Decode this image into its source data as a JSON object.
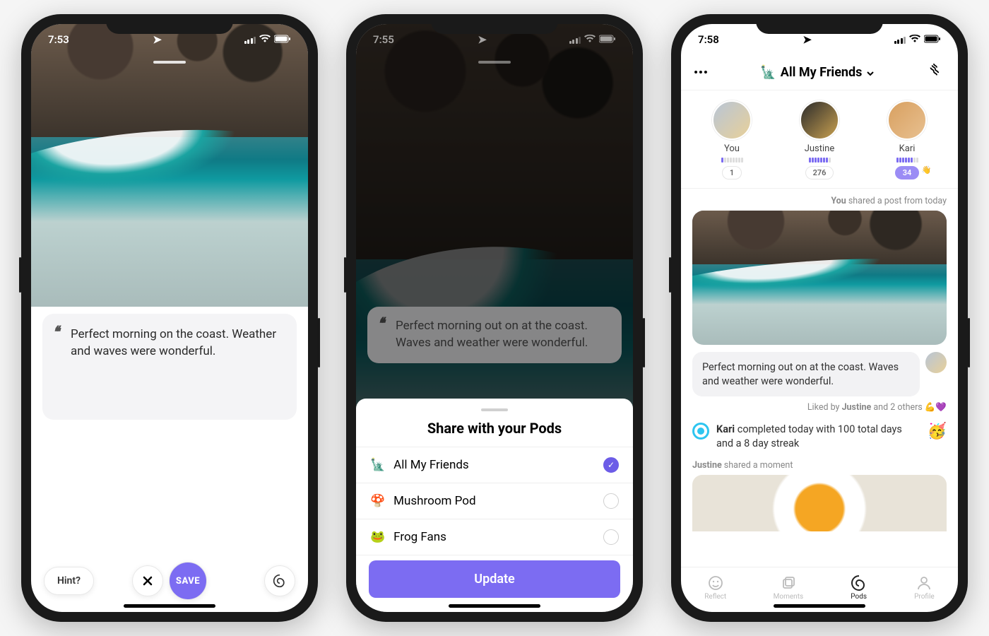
{
  "phone1": {
    "status_time": "7:53",
    "caption": "Perfect morning on the coast. Weather and waves were wonderful.",
    "hint_label": "Hint?",
    "save_label": "SAVE"
  },
  "phone2": {
    "status_time": "7:55",
    "caption": "Perfect morning out on at the coast. Waves and weather were wonderful.",
    "sheet_title": "Share with your Pods",
    "pods": [
      {
        "emoji": "🗽",
        "name": "All My Friends",
        "selected": true
      },
      {
        "emoji": "🍄",
        "name": "Mushroom Pod",
        "selected": false
      },
      {
        "emoji": "🐸",
        "name": "Frog Fans",
        "selected": false
      }
    ],
    "update_label": "Update"
  },
  "phone3": {
    "status_time": "7:58",
    "header_emoji": "🗽",
    "header_title": "All My Friends",
    "friends": [
      {
        "name": "You",
        "count": "1",
        "highlight": false
      },
      {
        "name": "Justine",
        "count": "276",
        "highlight": false
      },
      {
        "name": "Kari",
        "count": "34",
        "highlight": true
      }
    ],
    "share_meta_prefix": "You",
    "share_meta_suffix": " shared a post from today",
    "message": "Perfect morning out on at the coast. Waves and weather were wonderful.",
    "liked_prefix": "Liked by ",
    "liked_name": "Justine",
    "liked_suffix": " and 2 others 💪💜",
    "activity_name": "Kari",
    "activity_text": " completed today with 100 total days and a 8 day streak",
    "activity_emoji": "🥳",
    "moment_name": "Justine",
    "moment_suffix": " shared a moment",
    "tabs": [
      {
        "label": "Reflect",
        "active": false
      },
      {
        "label": "Moments",
        "active": false
      },
      {
        "label": "Pods",
        "active": true
      },
      {
        "label": "Profile",
        "active": false
      }
    ]
  }
}
